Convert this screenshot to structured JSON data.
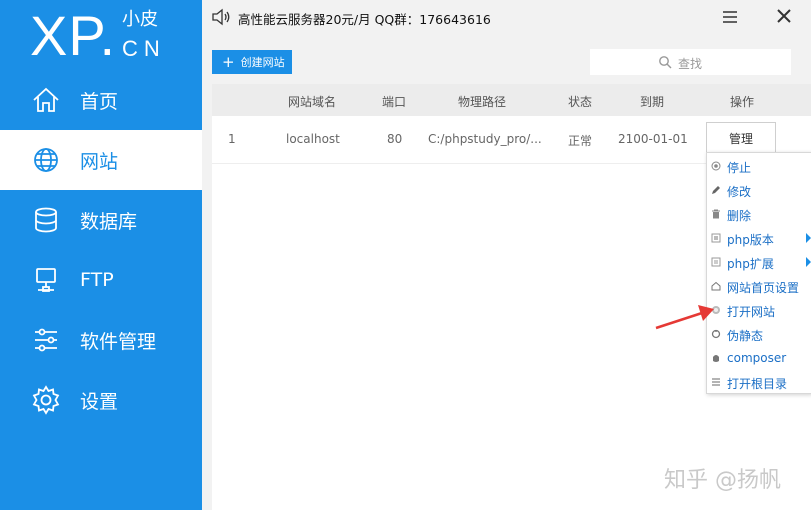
{
  "logo": {
    "main": "XP.",
    "top": "小皮",
    "bottom": "CN"
  },
  "nav": [
    {
      "label": "首页",
      "icon": "home-icon",
      "active": false
    },
    {
      "label": "网站",
      "icon": "globe-icon",
      "active": true
    },
    {
      "label": "数据库",
      "icon": "database-icon",
      "active": false
    },
    {
      "label": "FTP",
      "icon": "server-icon",
      "active": false
    },
    {
      "label": "软件管理",
      "icon": "sliders-icon",
      "active": false
    },
    {
      "label": "设置",
      "icon": "gear-icon",
      "active": false
    }
  ],
  "topbar": {
    "notice": "高性能云服务器20元/月  QQ群：176643616"
  },
  "toolbar": {
    "create_label": "创建网站",
    "search_placeholder": "查找"
  },
  "table": {
    "headers": [
      "网站域名",
      "端口",
      "物理路径",
      "状态",
      "到期",
      "操作"
    ],
    "rows": [
      {
        "index": "1",
        "domain": "localhost",
        "port": "80",
        "path": "C:/phpstudy_pro/...",
        "status": "正常",
        "expire": "2100-01-01",
        "action": "管理"
      }
    ]
  },
  "context_menu": [
    {
      "label": "停止",
      "icon": "stop-icon",
      "submenu": false
    },
    {
      "label": "修改",
      "icon": "pencil-icon",
      "submenu": false
    },
    {
      "label": "删除",
      "icon": "trash-icon",
      "submenu": false
    },
    {
      "label": "php版本",
      "icon": "php-icon",
      "submenu": true
    },
    {
      "label": "php扩展",
      "icon": "extension-icon",
      "submenu": true
    },
    {
      "label": "网站首页设置",
      "icon": "home-small-icon",
      "submenu": false
    },
    {
      "label": "打开网站",
      "icon": "browser-icon",
      "submenu": false
    },
    {
      "label": "伪静态",
      "icon": "rewrite-icon",
      "submenu": false
    },
    {
      "label": "composer",
      "icon": "composer-icon",
      "submenu": false
    },
    {
      "label": "打开根目录",
      "icon": "list-icon",
      "submenu": false
    }
  ],
  "watermark": "知乎 @扬帆",
  "colors": {
    "brand": "#1b8fe6",
    "menu_text": "#1b6fc6",
    "arrow": "#e53935"
  }
}
